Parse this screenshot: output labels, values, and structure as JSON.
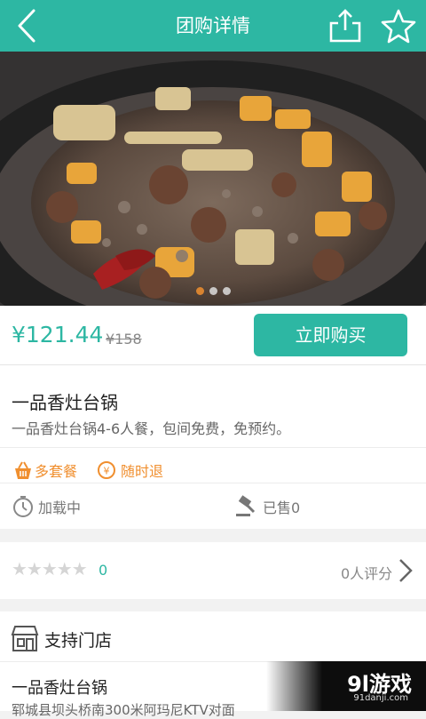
{
  "header": {
    "title": "团购详情",
    "icons": [
      "back-icon",
      "share-icon",
      "star-icon"
    ]
  },
  "price": {
    "current": "¥121.44",
    "original": "¥158",
    "buy_label": "立即购买"
  },
  "product": {
    "name": "一品香灶台锅",
    "description": "一品香灶台锅4-6人餐，包间免费，免预约。",
    "tags": [
      {
        "label": "多套餐",
        "icon": "basket-icon"
      },
      {
        "label": "随时退",
        "icon": "refund-icon"
      }
    ],
    "status": "加载中",
    "sold": "已售0"
  },
  "rating": {
    "count": "0",
    "reviews": "0人评分"
  },
  "stores": {
    "title": "支持门店",
    "name": "一品香灶台锅",
    "address": "郓城县坝头桥南300米阿玛尼KTV对面"
  },
  "watermark": {
    "brand": "9l游戏",
    "url": "91danji.com"
  },
  "colors": {
    "accent": "#2db7a3",
    "orange": "#f08f2f"
  }
}
